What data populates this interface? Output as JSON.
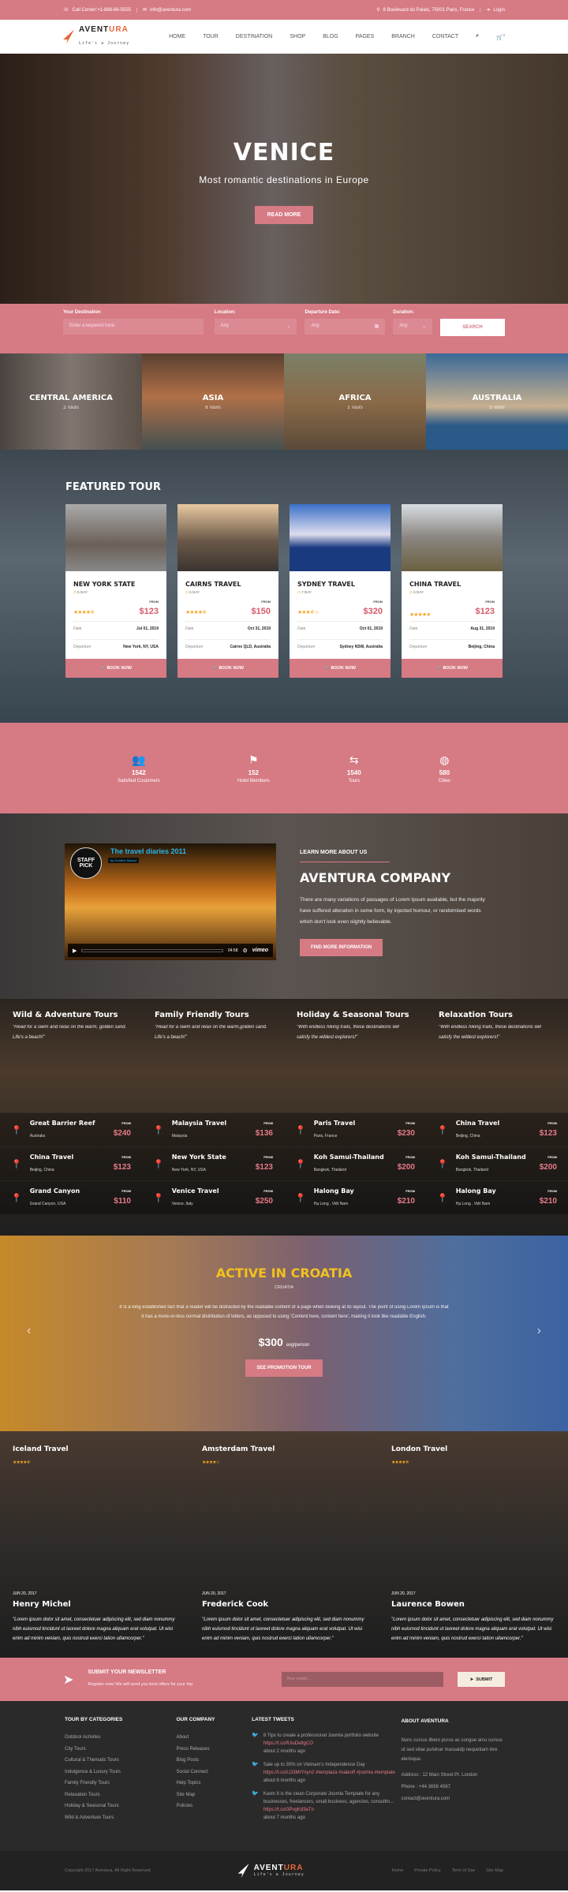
{
  "topbar": {
    "phone": "Call Center:+1-888-66-5555",
    "email": "info@aventura.com",
    "address": "8 Boulevard du Palais, 75001 Paris, France",
    "login": "Login"
  },
  "brand": {
    "name_a": "AVENT",
    "name_b": "URA",
    "tagline": "Life's a Journey",
    "accent": "#e3683a",
    "pink": "#d67a84"
  },
  "nav": {
    "items": [
      "HOME",
      "TOUR",
      "DESTINATION",
      "SHOP",
      "BLOG",
      "PAGES",
      "BRANCH",
      "CONTACT"
    ],
    "cart_count": "0"
  },
  "hero": {
    "title": "VENICE",
    "subtitle": "Most romantic destinations in Europe",
    "button": "READ MORE"
  },
  "search": {
    "destination_label": "Your Destination",
    "destination_placeholder": "Enter a keyword here",
    "location_label": "Location:",
    "location_value": "Any",
    "date_label": "Departure Date:",
    "date_value": "Any",
    "duration_label": "Duration:",
    "duration_value": "Any",
    "button": "SEARCH"
  },
  "regions": [
    {
      "name": "CENTRAL AMERICA",
      "tours": "2 Tours"
    },
    {
      "name": "ASIA",
      "tours": "8 Tours"
    },
    {
      "name": "AFRICA",
      "tours": "2 Tours"
    },
    {
      "name": "AUSTRALIA",
      "tours": "3 Tours"
    }
  ],
  "featured": {
    "title": "FEATURED TOUR",
    "date_label": "Date",
    "departure_label": "Departure",
    "from_label": "FROM",
    "book_label": "BOOK NOW",
    "tours": [
      {
        "name": "NEW YORK STATE",
        "duration": "5 DAY",
        "rating": 4.5,
        "price": "$123",
        "date": "Jul 01, 2019",
        "departure": "New York, NY, USA"
      },
      {
        "name": "CAIRNS TRAVEL",
        "duration": "5 DAY",
        "rating": 4.5,
        "price": "$150",
        "date": "Oct 31, 2019",
        "departure": "Cairns QLD, Australia"
      },
      {
        "name": "SYDNEY TRAVEL",
        "duration": "7 DAY",
        "rating": 3.5,
        "price": "$320",
        "date": "Oct 01, 2019",
        "departure": "Sydney NSW, Australia"
      },
      {
        "name": "CHINA TRAVEL",
        "duration": "5 DAY",
        "rating": 5,
        "price": "$123",
        "date": "Aug 31, 2019",
        "departure": "Beijing, China"
      }
    ]
  },
  "stats": [
    {
      "icon": "users-icon",
      "value": "1542",
      "label": "Satisfied Customers"
    },
    {
      "icon": "flag-icon",
      "value": "152",
      "label": "Hotel Members"
    },
    {
      "icon": "signpost-icon",
      "value": "1540",
      "label": "Tours"
    },
    {
      "icon": "globe-icon",
      "value": "580",
      "label": "Cities"
    }
  ],
  "about": {
    "video_title": "The travel diaries 2011",
    "video_byline": "by Gunther Machu",
    "video_badge": "STAFF PICK",
    "video_time": "04:58",
    "video_brand": "vimeo",
    "eyebrow": "LEARN MORE ABOUT US",
    "title": "AVENTURA COMPANY",
    "text": "There are many variations of passages of Lorem Ipsum available, but the majority have suffered alteration in some form, by injected humour, or randomised words which don't look even slightly believable.",
    "button": "FIND MORE INFORMATION"
  },
  "categories": [
    {
      "title": "Wild & Adventure Tours",
      "quote": "\"Head for a swim and relax on the warm, golden sand. Life's a beach!\"",
      "dests": [
        {
          "name": "Great Barrier Reef",
          "loc": "Australia",
          "price": "$240"
        },
        {
          "name": "China Travel",
          "loc": "Beijing, China",
          "price": "$123"
        },
        {
          "name": "Grand Canyon",
          "loc": "Grand Canyon, USA",
          "price": "$110"
        }
      ]
    },
    {
      "title": "Family Friendly Tours",
      "quote": "\"Head for a swim and relax on the warm,golden sand. Life's a beach!\"",
      "dests": [
        {
          "name": "Malaysia Travel",
          "loc": "Malaysia",
          "price": "$136"
        },
        {
          "name": "New York State",
          "loc": "New York, NY, USA",
          "price": "$123"
        },
        {
          "name": "Venice Travel",
          "loc": "Venice, Italy",
          "price": "$250"
        }
      ]
    },
    {
      "title": "Holiday & Seasonal Tours",
      "quote": "\"With endless hiking trails, these destinations will satisfy the wildest explorers!\"",
      "dests": [
        {
          "name": "Paris Travel",
          "loc": "Paris, France",
          "price": "$230"
        },
        {
          "name": "Koh Samui-Thailand",
          "loc": "Bangkok, Thailand",
          "price": "$200"
        },
        {
          "name": "Halong Bay",
          "loc": "Hạ Long , Việt Nam",
          "price": "$210"
        }
      ]
    },
    {
      "title": "Relaxation Tours",
      "quote": "\"With endless hiking trails, these destinations will satisfy the wildest explorers!\"",
      "dests": [
        {
          "name": "China Travel",
          "loc": "Beijing, China",
          "price": "$123"
        },
        {
          "name": "Koh Samui-Thailand",
          "loc": "Bangkok, Thailand",
          "price": "$200"
        },
        {
          "name": "Halong Bay",
          "loc": "Hạ Long , Việt Nam",
          "price": "$210"
        }
      ]
    }
  ],
  "promo": {
    "title": "ACTIVE IN CROATIA",
    "subtitle": "CROATIA",
    "text": "It is a long established fact that a reader will be distracted by the readable content of a page when looking at its layout. The point of using Lorem Ipsum is that it has a more-or-less normal distribution of letters, as opposed to using 'Content here, content here', making it look like readable English.",
    "price": "$300",
    "price_unit": "avg/person",
    "button": "SEE PROMOTION TOUR"
  },
  "testimonials": [
    {
      "tour": "Iceland Travel",
      "rating": 4.5,
      "date": "JUN 20, 2017",
      "name": "Henry Michel",
      "quote": "\"Lorem ipsum dolor sit amet, consectetuer adipiscing elit, sed diam nonummy nibh euismod tincidunt ut laoreet dolore magna aliquam erat volutpat. Ut wisi enim ad minim veniam, quis nostrud exerci tation ullamcorper.\""
    },
    {
      "tour": "Amsterdam Travel",
      "rating": 4,
      "date": "JUN 20, 2017",
      "name": "Frederick Cook",
      "quote": "\"Lorem ipsum dolor sit amet, consectetuer adipiscing elit, sed diam nonummy nibh euismod tincidunt ut laoreet dolore magna aliquam erat volutpat. Ut wisi enim ad minim veniam, quis nostrud exerci tation ullamcorper.\""
    },
    {
      "tour": "London Travel",
      "rating": 4.5,
      "date": "JUN 20, 2017",
      "name": "Laurence Bowen",
      "quote": "\"Lorem ipsum dolor sit amet, consectetuer adipiscing elit, sed diam nonummy nibh euismod tincidunt ut laoreet dolore magna aliquam erat volutpat. Ut wisi enim ad minim veniam, quis nostrud exerci tation ullamcorper.\""
    }
  ],
  "newsletter": {
    "title": "SUBMIT YOUR NEWSLETTER",
    "text": "Register now! We will send you best offers for your trip.",
    "placeholder": "Your email...",
    "button": "SUBMIT"
  },
  "footer": {
    "col1_title": "TOUR BY CATEGORIES",
    "col1": [
      "Outdoor Activites",
      "City Tours",
      "Cultural & Thematic Tours",
      "Indulgence & Luxury Tours",
      "Family Friendly Tours",
      "Relaxation Tours",
      "Holiday & Seasonal Tours",
      "Wild & Adventure Tours"
    ],
    "col2_title": "OUR COMPANY",
    "col2": [
      "About",
      "Press Releases",
      "Blog Posts",
      "Social Connect",
      "Help Topics",
      "Site Map",
      "Policies"
    ],
    "col3_title": "LATEST TWEETS",
    "tweets": [
      {
        "text": "8 Tips to create a professional Joomla portfolio website ",
        "link": "https://t.co/fUiuDeltgCO",
        "time": "about 2 months ago"
      },
      {
        "text": "Sale up to 30% on Vietnam's Independence Day ",
        "link": "https://t.co/LO3MtYnyn2 #templaza #saleoff #joomla #template",
        "time": "about 6 months ago"
      },
      {
        "text": "Kavin II is the clean Corporate Joomla Template for any businesses, freelancers, small business, agencies, consultin... ",
        "link": "https://t.co/3PvgKd3aTn",
        "time": "about 7 months ago"
      }
    ],
    "col4_title": "ABOUT AVENTURA",
    "about_text": "Nunc cursus libero purus ac congue arcu cursus ut sed vitae pulvinar massaidp nequetiam lore elerisque.",
    "address": "Address : 12 Main Street Pt. London",
    "phone": "Phone : +44 3656 4567",
    "email": "contact@aventura.com",
    "copyright": "Copyright 2017 Aventura. All Right Reserved",
    "links": [
      "Home",
      "Private Policy",
      "Term of Use",
      "Site Map"
    ]
  }
}
